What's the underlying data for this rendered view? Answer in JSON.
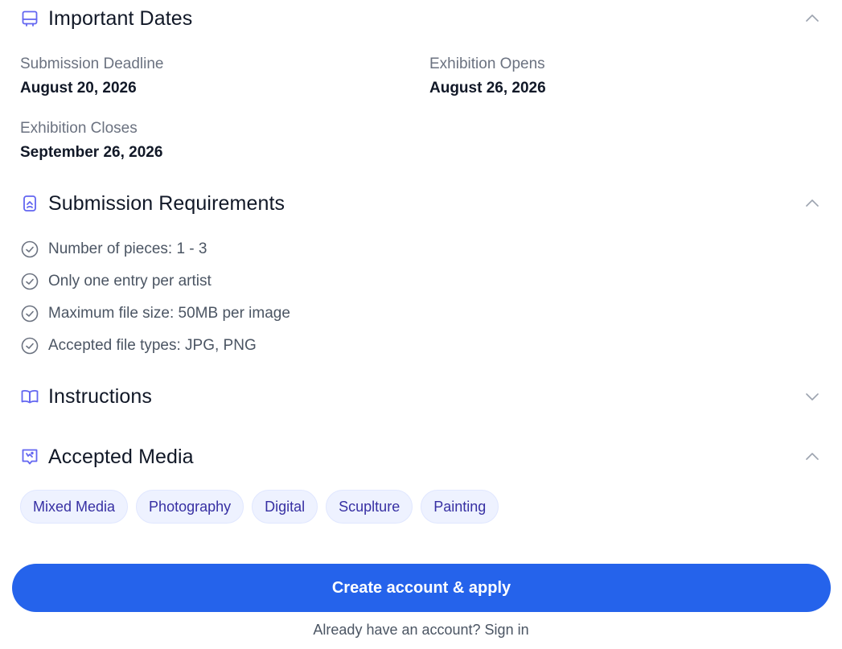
{
  "sections": {
    "important_dates": {
      "title": "Important Dates",
      "icon": "calendar-icon",
      "expanded": true,
      "items": [
        {
          "label": "Submission Deadline",
          "value": "August 20, 2026"
        },
        {
          "label": "Exhibition Opens",
          "value": "August 26, 2026"
        },
        {
          "label": "Exhibition Closes",
          "value": "September 26, 2026"
        }
      ]
    },
    "submission_requirements": {
      "title": "Submission Requirements",
      "icon": "badge-icon",
      "expanded": true,
      "items": [
        "Number of pieces: 1 - 3",
        "Only one entry per artist",
        "Maximum file size: 50MB per image",
        "Accepted file types: JPG, PNG"
      ]
    },
    "instructions": {
      "title": "Instructions",
      "icon": "book-open-icon",
      "expanded": false
    },
    "accepted_media": {
      "title": "Accepted Media",
      "icon": "image-frame-icon",
      "expanded": true,
      "chips": [
        "Mixed Media",
        "Photography",
        "Digital",
        "Scuplture",
        "Painting"
      ]
    }
  },
  "cta": {
    "label": "Create account & apply",
    "signin_text": "Already have an account? Sign in"
  },
  "colors": {
    "accent": "#2563eb",
    "icon": "#6366f1",
    "chip_bg": "#eef2ff",
    "chip_text": "#3730a3",
    "muted": "#6b7280"
  }
}
